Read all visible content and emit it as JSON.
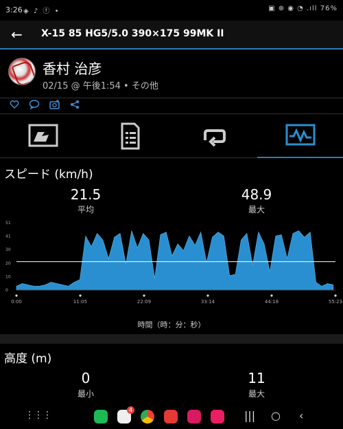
{
  "status_bar": {
    "time": "3:26",
    "left_icons": "◈ ♪ ⓕ •",
    "battery": "76%",
    "right_icons": "▣ ⊕ ◉ ◔ .ıll"
  },
  "app_bar": {
    "title": "X-15 85 HG5/5.0 390×175 99MK II"
  },
  "activity": {
    "user_name": "香村 治彦",
    "meta": "02/15 @ 午後1:54 • その他"
  },
  "speed": {
    "title": "スピード (km/h)",
    "avg_value": "21.5",
    "avg_label": "平均",
    "max_value": "48.9",
    "max_label": "最大",
    "axis_caption": "時間（時：分：秒）"
  },
  "chart_data": {
    "type": "area",
    "title": "スピード (km/h)",
    "xlabel": "時間（時：分：秒）",
    "ylabel": "",
    "x_tick_labels": [
      "0:00",
      "11:05",
      "22:09",
      "33:14",
      "44:18",
      "55:23"
    ],
    "y_tick_labels": [
      "0",
      "10",
      "20",
      "30",
      "41",
      "51"
    ],
    "ylim": [
      0,
      51
    ],
    "xlim": [
      0,
      55.38
    ],
    "reference_line": 21.5,
    "accent_color": "#2a8fd0",
    "x": [
      0,
      1,
      2,
      3,
      4,
      5,
      6,
      7,
      8,
      9,
      10,
      11,
      12,
      13,
      14,
      15,
      16,
      17,
      18,
      19,
      20,
      21,
      22,
      23,
      24,
      25,
      26,
      27,
      28,
      29,
      30,
      31,
      32,
      33,
      34,
      35,
      36,
      37,
      38,
      39,
      40,
      41,
      42,
      43,
      44,
      45,
      46,
      47,
      48,
      49,
      50,
      51,
      52,
      53,
      54,
      55
    ],
    "values": [
      3,
      5,
      4,
      3,
      3,
      4,
      6,
      5,
      4,
      3,
      6,
      8,
      41,
      33,
      43,
      38,
      24,
      40,
      43,
      20,
      45,
      32,
      43,
      38,
      9,
      42,
      44,
      26,
      35,
      30,
      41,
      34,
      44,
      21,
      40,
      44,
      41,
      11,
      12,
      38,
      43,
      19,
      44,
      35,
      14,
      41,
      42,
      24,
      43,
      45,
      40,
      44,
      6,
      3,
      5,
      4
    ]
  },
  "elevation": {
    "title": "高度 (m)",
    "min_value": "0",
    "min_label": "最小",
    "max_value": "11",
    "max_label": "最大"
  },
  "nav_bar": {
    "mail_badge": "4"
  }
}
